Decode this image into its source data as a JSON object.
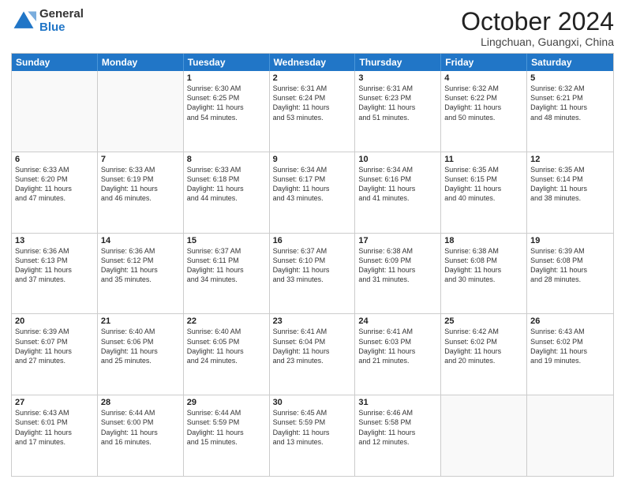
{
  "logo": {
    "general": "General",
    "blue": "Blue"
  },
  "title": "October 2024",
  "location": "Lingchuan, Guangxi, China",
  "header_days": [
    "Sunday",
    "Monday",
    "Tuesday",
    "Wednesday",
    "Thursday",
    "Friday",
    "Saturday"
  ],
  "weeks": [
    [
      {
        "day": "",
        "lines": []
      },
      {
        "day": "",
        "lines": []
      },
      {
        "day": "1",
        "lines": [
          "Sunrise: 6:30 AM",
          "Sunset: 6:25 PM",
          "Daylight: 11 hours",
          "and 54 minutes."
        ]
      },
      {
        "day": "2",
        "lines": [
          "Sunrise: 6:31 AM",
          "Sunset: 6:24 PM",
          "Daylight: 11 hours",
          "and 53 minutes."
        ]
      },
      {
        "day": "3",
        "lines": [
          "Sunrise: 6:31 AM",
          "Sunset: 6:23 PM",
          "Daylight: 11 hours",
          "and 51 minutes."
        ]
      },
      {
        "day": "4",
        "lines": [
          "Sunrise: 6:32 AM",
          "Sunset: 6:22 PM",
          "Daylight: 11 hours",
          "and 50 minutes."
        ]
      },
      {
        "day": "5",
        "lines": [
          "Sunrise: 6:32 AM",
          "Sunset: 6:21 PM",
          "Daylight: 11 hours",
          "and 48 minutes."
        ]
      }
    ],
    [
      {
        "day": "6",
        "lines": [
          "Sunrise: 6:33 AM",
          "Sunset: 6:20 PM",
          "Daylight: 11 hours",
          "and 47 minutes."
        ]
      },
      {
        "day": "7",
        "lines": [
          "Sunrise: 6:33 AM",
          "Sunset: 6:19 PM",
          "Daylight: 11 hours",
          "and 46 minutes."
        ]
      },
      {
        "day": "8",
        "lines": [
          "Sunrise: 6:33 AM",
          "Sunset: 6:18 PM",
          "Daylight: 11 hours",
          "and 44 minutes."
        ]
      },
      {
        "day": "9",
        "lines": [
          "Sunrise: 6:34 AM",
          "Sunset: 6:17 PM",
          "Daylight: 11 hours",
          "and 43 minutes."
        ]
      },
      {
        "day": "10",
        "lines": [
          "Sunrise: 6:34 AM",
          "Sunset: 6:16 PM",
          "Daylight: 11 hours",
          "and 41 minutes."
        ]
      },
      {
        "day": "11",
        "lines": [
          "Sunrise: 6:35 AM",
          "Sunset: 6:15 PM",
          "Daylight: 11 hours",
          "and 40 minutes."
        ]
      },
      {
        "day": "12",
        "lines": [
          "Sunrise: 6:35 AM",
          "Sunset: 6:14 PM",
          "Daylight: 11 hours",
          "and 38 minutes."
        ]
      }
    ],
    [
      {
        "day": "13",
        "lines": [
          "Sunrise: 6:36 AM",
          "Sunset: 6:13 PM",
          "Daylight: 11 hours",
          "and 37 minutes."
        ]
      },
      {
        "day": "14",
        "lines": [
          "Sunrise: 6:36 AM",
          "Sunset: 6:12 PM",
          "Daylight: 11 hours",
          "and 35 minutes."
        ]
      },
      {
        "day": "15",
        "lines": [
          "Sunrise: 6:37 AM",
          "Sunset: 6:11 PM",
          "Daylight: 11 hours",
          "and 34 minutes."
        ]
      },
      {
        "day": "16",
        "lines": [
          "Sunrise: 6:37 AM",
          "Sunset: 6:10 PM",
          "Daylight: 11 hours",
          "and 33 minutes."
        ]
      },
      {
        "day": "17",
        "lines": [
          "Sunrise: 6:38 AM",
          "Sunset: 6:09 PM",
          "Daylight: 11 hours",
          "and 31 minutes."
        ]
      },
      {
        "day": "18",
        "lines": [
          "Sunrise: 6:38 AM",
          "Sunset: 6:08 PM",
          "Daylight: 11 hours",
          "and 30 minutes."
        ]
      },
      {
        "day": "19",
        "lines": [
          "Sunrise: 6:39 AM",
          "Sunset: 6:08 PM",
          "Daylight: 11 hours",
          "and 28 minutes."
        ]
      }
    ],
    [
      {
        "day": "20",
        "lines": [
          "Sunrise: 6:39 AM",
          "Sunset: 6:07 PM",
          "Daylight: 11 hours",
          "and 27 minutes."
        ]
      },
      {
        "day": "21",
        "lines": [
          "Sunrise: 6:40 AM",
          "Sunset: 6:06 PM",
          "Daylight: 11 hours",
          "and 25 minutes."
        ]
      },
      {
        "day": "22",
        "lines": [
          "Sunrise: 6:40 AM",
          "Sunset: 6:05 PM",
          "Daylight: 11 hours",
          "and 24 minutes."
        ]
      },
      {
        "day": "23",
        "lines": [
          "Sunrise: 6:41 AM",
          "Sunset: 6:04 PM",
          "Daylight: 11 hours",
          "and 23 minutes."
        ]
      },
      {
        "day": "24",
        "lines": [
          "Sunrise: 6:41 AM",
          "Sunset: 6:03 PM",
          "Daylight: 11 hours",
          "and 21 minutes."
        ]
      },
      {
        "day": "25",
        "lines": [
          "Sunrise: 6:42 AM",
          "Sunset: 6:02 PM",
          "Daylight: 11 hours",
          "and 20 minutes."
        ]
      },
      {
        "day": "26",
        "lines": [
          "Sunrise: 6:43 AM",
          "Sunset: 6:02 PM",
          "Daylight: 11 hours",
          "and 19 minutes."
        ]
      }
    ],
    [
      {
        "day": "27",
        "lines": [
          "Sunrise: 6:43 AM",
          "Sunset: 6:01 PM",
          "Daylight: 11 hours",
          "and 17 minutes."
        ]
      },
      {
        "day": "28",
        "lines": [
          "Sunrise: 6:44 AM",
          "Sunset: 6:00 PM",
          "Daylight: 11 hours",
          "and 16 minutes."
        ]
      },
      {
        "day": "29",
        "lines": [
          "Sunrise: 6:44 AM",
          "Sunset: 5:59 PM",
          "Daylight: 11 hours",
          "and 15 minutes."
        ]
      },
      {
        "day": "30",
        "lines": [
          "Sunrise: 6:45 AM",
          "Sunset: 5:59 PM",
          "Daylight: 11 hours",
          "and 13 minutes."
        ]
      },
      {
        "day": "31",
        "lines": [
          "Sunrise: 6:46 AM",
          "Sunset: 5:58 PM",
          "Daylight: 11 hours",
          "and 12 minutes."
        ]
      },
      {
        "day": "",
        "lines": []
      },
      {
        "day": "",
        "lines": []
      }
    ]
  ]
}
